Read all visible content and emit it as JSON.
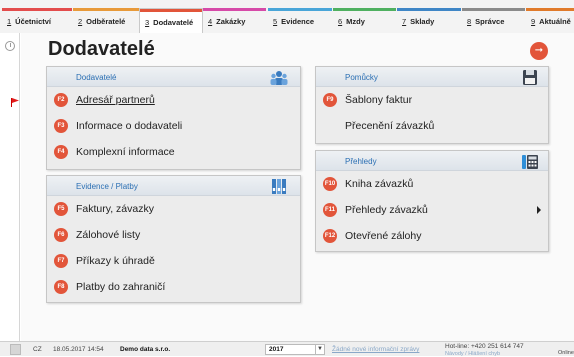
{
  "tabs": [
    {
      "num": "1",
      "label": "Účetnictví",
      "color": "#e34c4c"
    },
    {
      "num": "2",
      "label": "Odběratelé",
      "color": "#e89a3a"
    },
    {
      "num": "3",
      "label": "Dodavatelé",
      "color": "#e2553a",
      "active": true
    },
    {
      "num": "4",
      "label": "Zakázky",
      "color": "#d64aa8"
    },
    {
      "num": "5",
      "label": "Evidence",
      "color": "#49a5d8"
    },
    {
      "num": "6",
      "label": "Mzdy",
      "color": "#4fb060"
    },
    {
      "num": "7",
      "label": "Sklady",
      "color": "#3f86c6"
    },
    {
      "num": "8",
      "label": "Správce",
      "color": "#8a8a8a"
    },
    {
      "num": "9",
      "label": "Aktuálně",
      "color": "#e07a2a"
    }
  ],
  "page_title": "Dodavatelé",
  "panels": {
    "dodavatele": {
      "title": "Dodavatelé",
      "items": [
        {
          "key": "F2",
          "label": "Adresář partnerů"
        },
        {
          "key": "F3",
          "label": "Informace o dodavateli"
        },
        {
          "key": "F4",
          "label": "Komplexní informace"
        }
      ]
    },
    "evidence": {
      "title": "Evidence / Platby",
      "items": [
        {
          "key": "F5",
          "label": "Faktury, závazky"
        },
        {
          "key": "F6",
          "label": "Zálohové listy"
        },
        {
          "key": "F7",
          "label": "Příkazy k úhradě"
        },
        {
          "key": "F8",
          "label": "Platby do zahraničí"
        }
      ]
    },
    "pomucky": {
      "title": "Pomůcky",
      "items": [
        {
          "key": "F9",
          "label": "Šablony faktur"
        },
        {
          "key": "",
          "label": "Přecenění závazků"
        }
      ]
    },
    "prehledy": {
      "title": "Přehledy",
      "items": [
        {
          "key": "F10",
          "label": "Kniha závazků"
        },
        {
          "key": "F11",
          "label": "Přehledy závazků"
        },
        {
          "key": "F12",
          "label": "Otevřené zálohy"
        }
      ]
    }
  },
  "status": {
    "locale": "CZ",
    "datetime": "18.05.2017 14:54",
    "company": "Demo data s.r.o.",
    "year": "2017",
    "messages": "Žádné nové informační zprávy",
    "hotline": "Hot-line: +420 251 614 747",
    "hotline2": "Návody / Hlášení chyb",
    "online": "Online"
  },
  "colors": {
    "accent": "#e2553a",
    "panel_title": "#2b6fb3"
  }
}
